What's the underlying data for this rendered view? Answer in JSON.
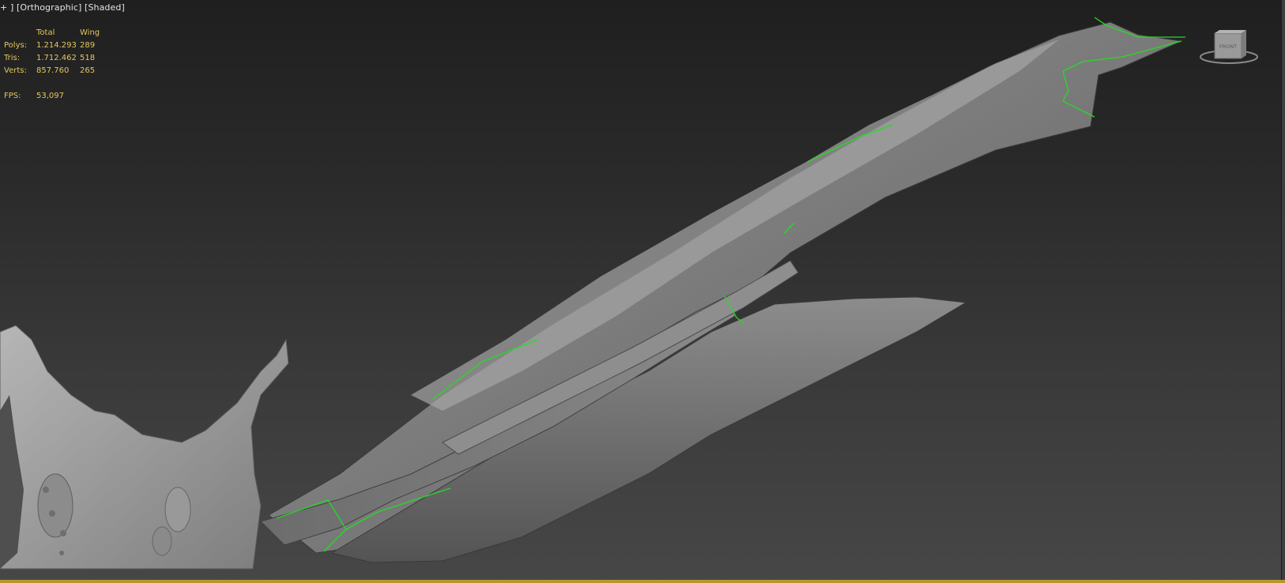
{
  "viewport": {
    "label_parts": [
      "+",
      "]",
      "[Orthographic]",
      "[Shaded]"
    ]
  },
  "stats": {
    "col_total": "Total",
    "col_wing": "Wing",
    "rows": [
      {
        "label": "Polys:",
        "total": "1.214.293",
        "wing": "289"
      },
      {
        "label": "Tris:",
        "total": "1.712.462",
        "wing": "518"
      },
      {
        "label": "Verts:",
        "total": "857.760",
        "wing": "265"
      }
    ],
    "fps_label": "FPS:",
    "fps_value": "53,097"
  },
  "viewcube": {
    "face_label": "FRONT",
    "icon": "viewcube-icon"
  },
  "colors": {
    "stats_text": "#e3c65e",
    "label_text": "#e4e4e4",
    "selection_edge": "#22dd22",
    "viewport_border": "#b8962f"
  }
}
